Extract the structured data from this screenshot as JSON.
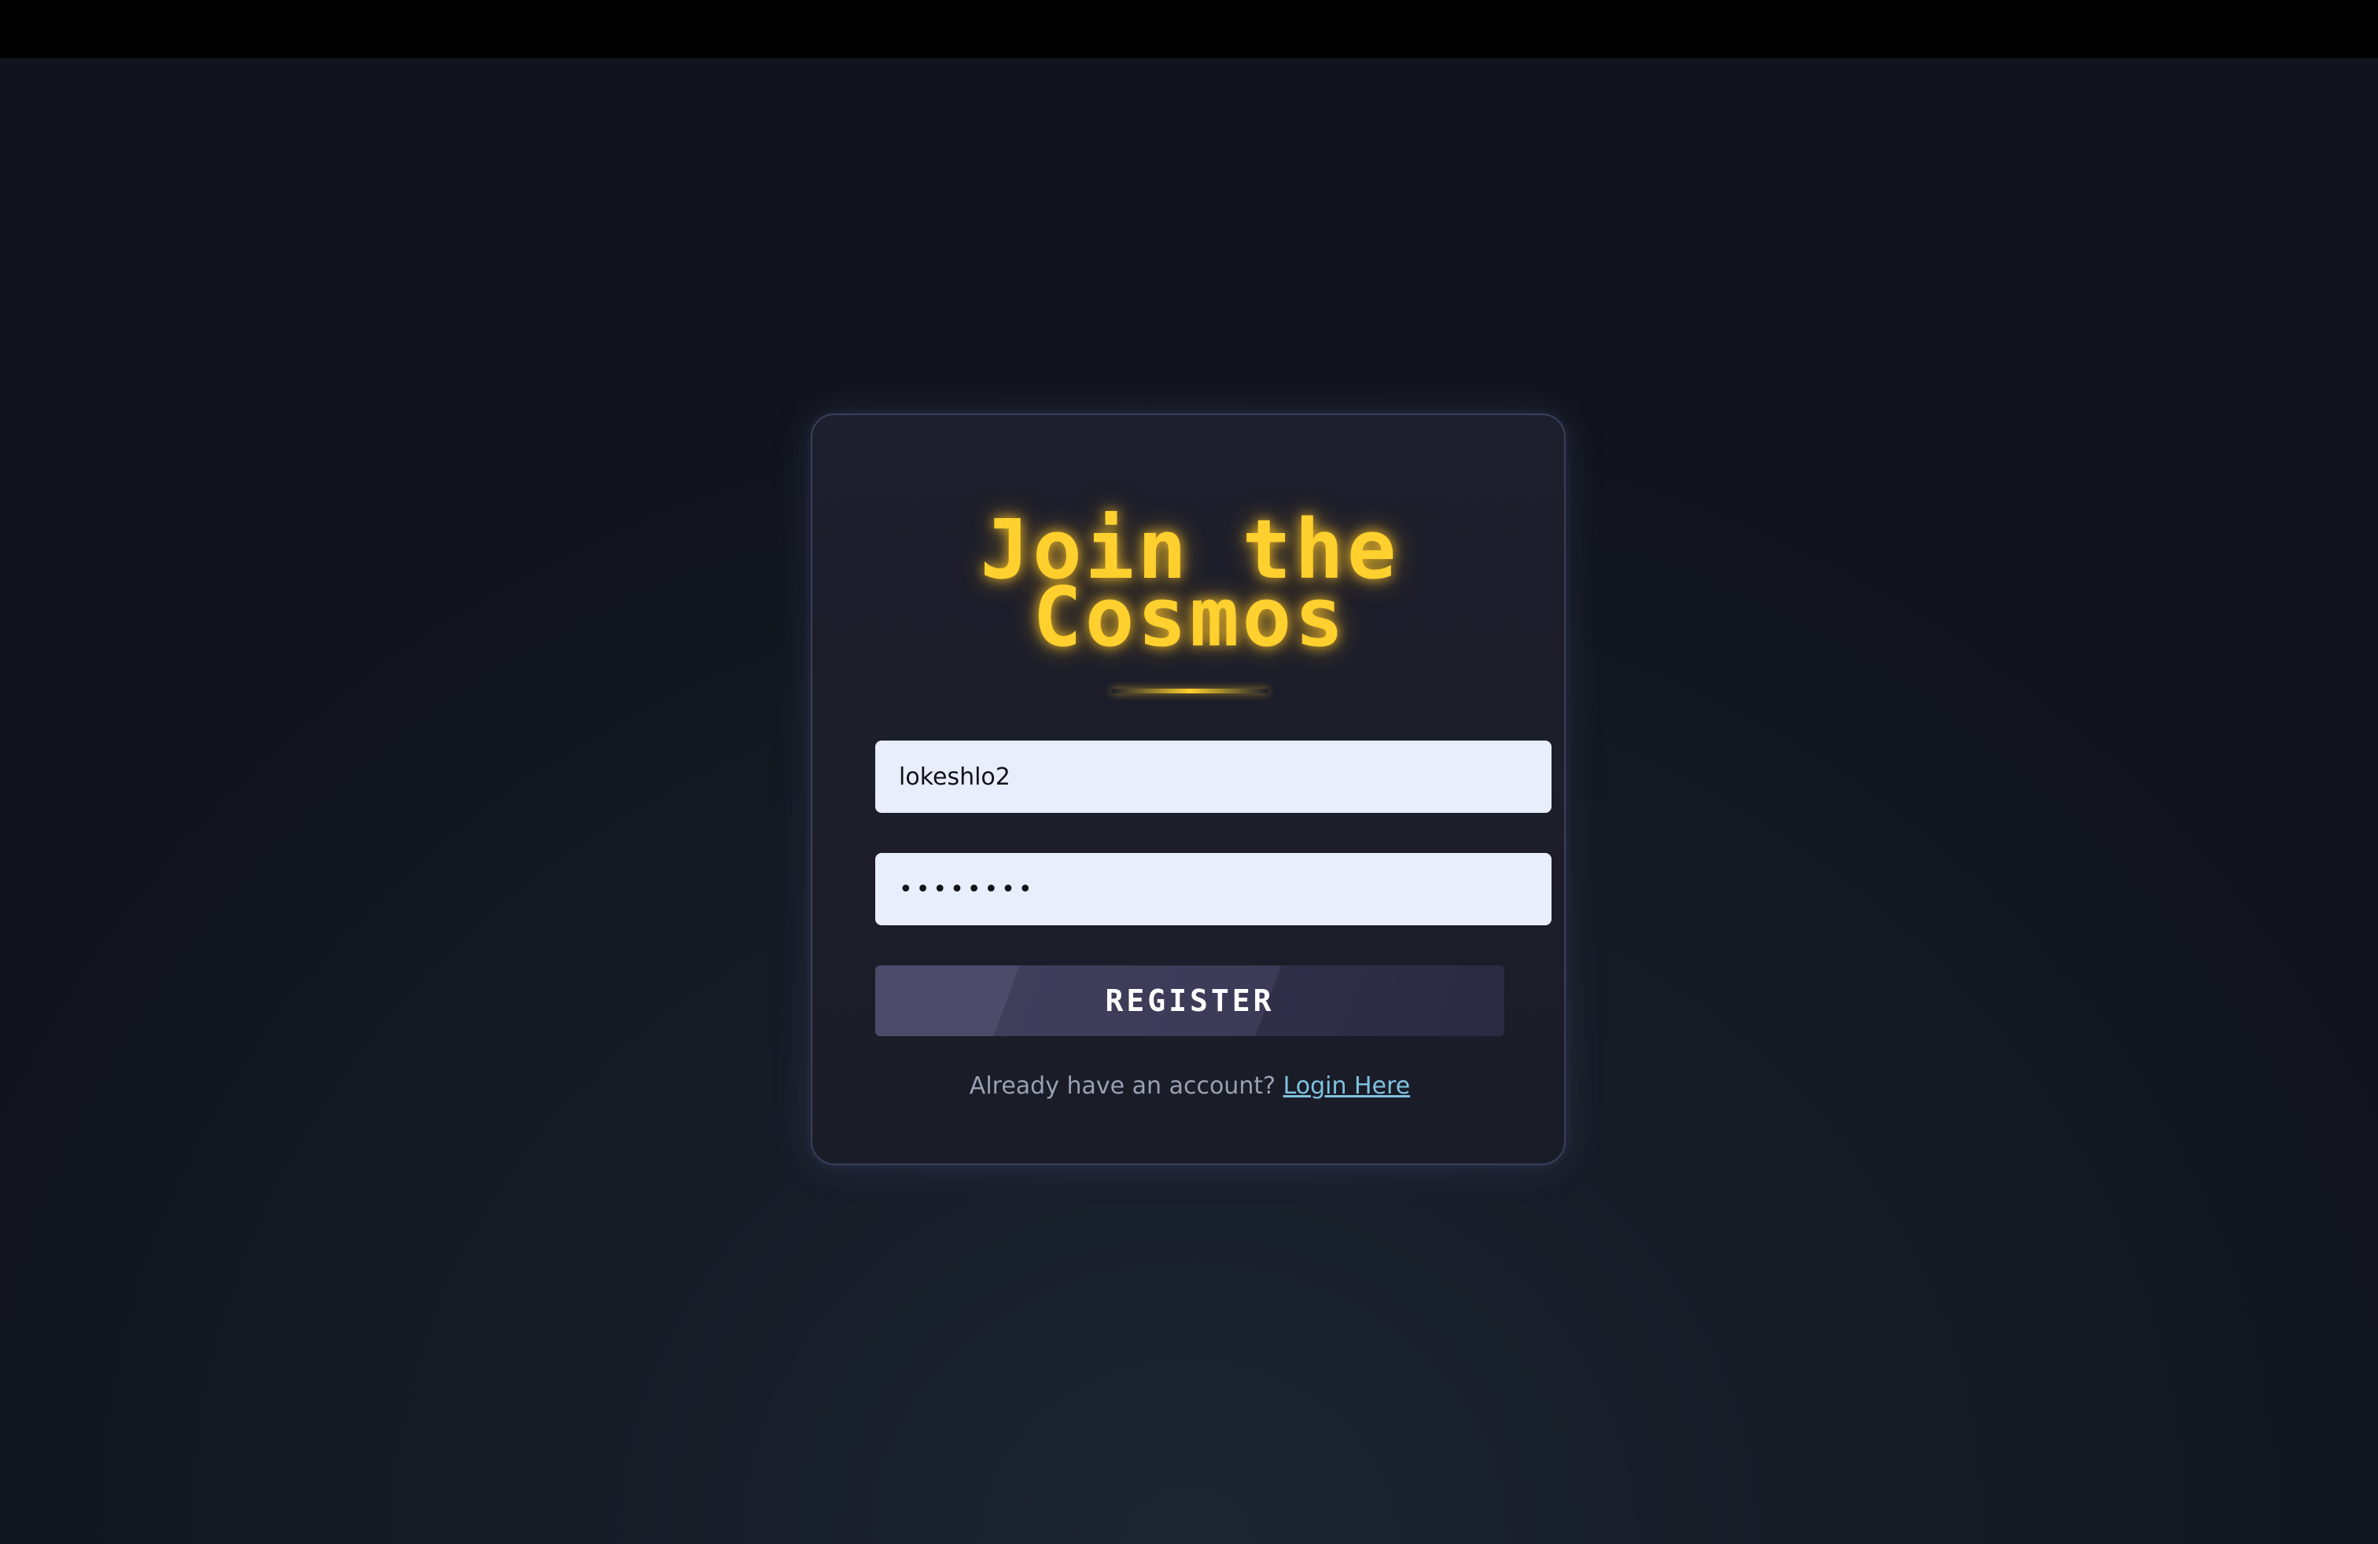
{
  "page": {
    "colors": {
      "background": "#11141c",
      "card": "#1e1f2c",
      "accent_yellow": "#ffd02e",
      "input_bg": "#e8eefc",
      "link": "#7fc2df",
      "button": "#3b3b58"
    }
  },
  "card": {
    "title_line1": "Join the",
    "title_line2": "Cosmos",
    "username_value": "lokeshlo2",
    "password_value": "••••••••",
    "register_label": "REGISTER",
    "footer_text": "Already have an account?",
    "login_link_label": "Login Here"
  }
}
